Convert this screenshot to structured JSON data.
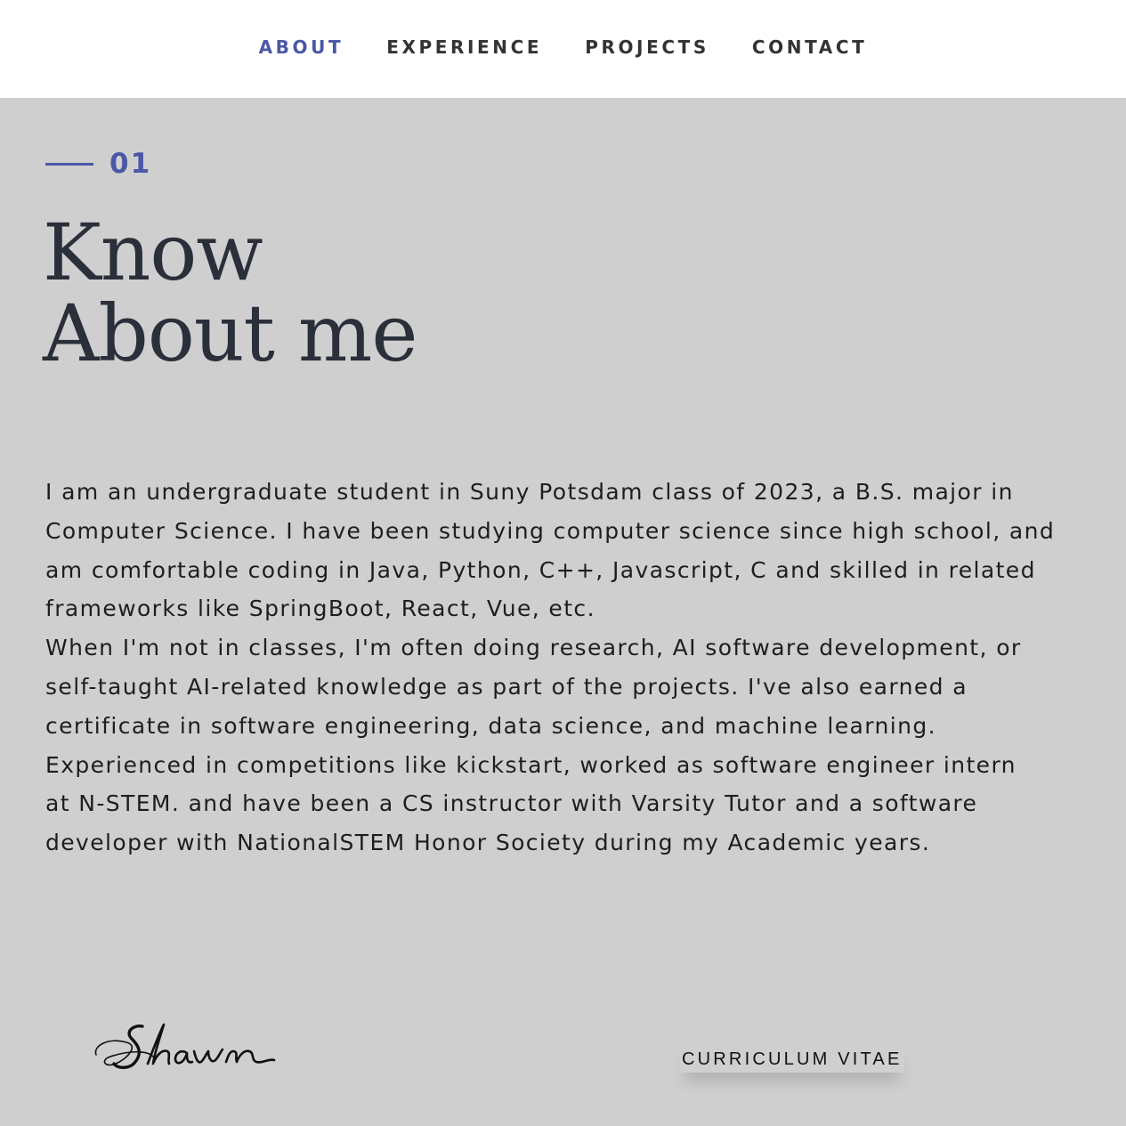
{
  "nav": {
    "items": [
      {
        "label": "ABOUT",
        "active": true
      },
      {
        "label": "EXPERIENCE",
        "active": false
      },
      {
        "label": "PROJECTS",
        "active": false
      },
      {
        "label": "CONTACT",
        "active": false
      }
    ]
  },
  "about": {
    "section_number": "01",
    "heading_line1": "Know",
    "heading_line2": "About me",
    "paragraph1": "I am an undergraduate student in Suny Potsdam class of 2023, a B.S. major in\nComputer Science. I have been studying computer science since high school, and\nam comfortable coding in Java, Python, C++, Javascript, C and skilled in related\nframeworks like SpringBoot, React, Vue, etc.",
    "paragraph2": "When I'm not in classes, I'm often doing research, AI software development, or\nself-taught AI-related knowledge as part of the projects. I've also earned a\ncertificate in software engineering, data science, and machine learning.\nExperienced in competitions like kickstart, worked as software engineer intern\nat N-STEM. and have been a CS instructor with Varsity Tutor and a software\ndeveloper with NationalSTEM Honor Society during my Academic years."
  },
  "footer": {
    "signature": "Shawn",
    "cv_label": "CURRICULUM VITAE"
  },
  "colors": {
    "accent": "#4a58a6",
    "background": "#cfcfcf",
    "header_bg": "#ffffff",
    "text": "#1e1e1e"
  }
}
